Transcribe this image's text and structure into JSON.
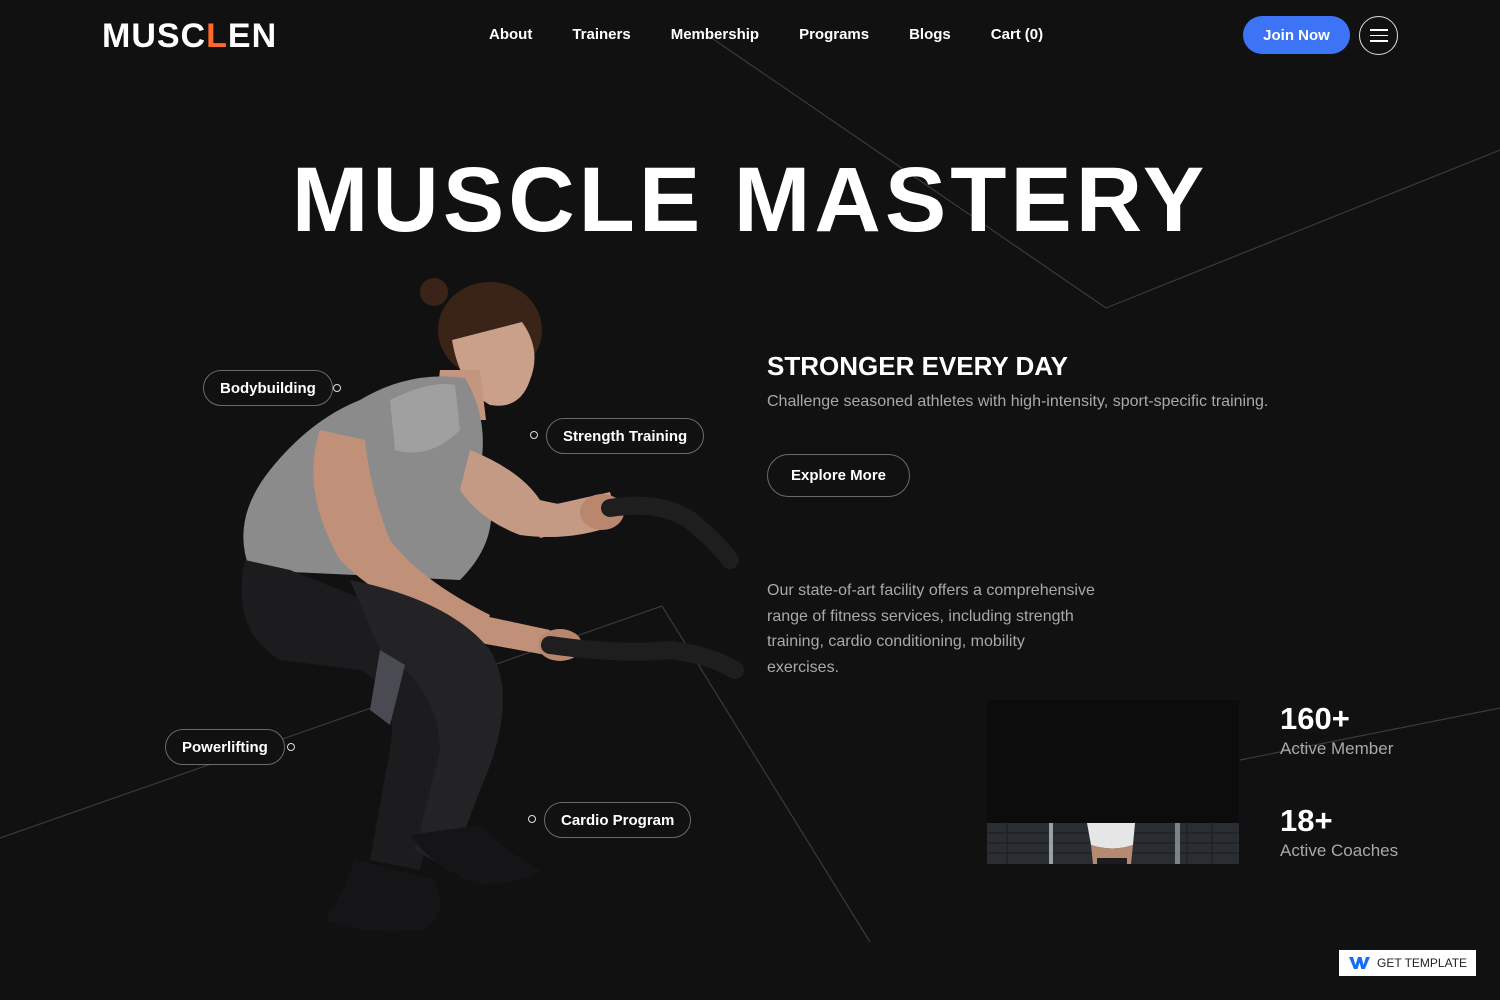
{
  "brand": {
    "prefix": "MUSC",
    "accent_letter": "L",
    "suffix": "EN",
    "accent_color": "#ff6a2a"
  },
  "nav": {
    "items": [
      {
        "label": "About"
      },
      {
        "label": "Trainers"
      },
      {
        "label": "Membership"
      },
      {
        "label": "Programs"
      },
      {
        "label": "Blogs"
      },
      {
        "label": "Cart",
        "count": "(0)"
      }
    ],
    "join_label": "Join Now",
    "menu_icon": "hamburger-icon"
  },
  "hero": {
    "title": "MUSCLE MASTERY",
    "tags": {
      "bodybuilding": "Bodybuilding",
      "strength": "Strength Training",
      "powerlifting": "Powerlifting",
      "cardio": "Cardio Program"
    }
  },
  "content": {
    "subheading": "STRONGER EVERY DAY",
    "subtext": "Challenge seasoned athletes with high-intensity, sport-specific training.",
    "explore_label": "Explore More",
    "description": "Our state-of-art facility offers a comprehensive range of fitness services, including strength training, cardio conditioning, mobility exercises."
  },
  "stats": [
    {
      "value": "160+",
      "label": "Active Member"
    },
    {
      "value": "18+",
      "label": "Active Coaches"
    }
  ],
  "badge": {
    "label": "GET TEMPLATE",
    "icon": "webflow-logo-icon"
  },
  "colors": {
    "background": "#111112",
    "primary": "#3d73f5",
    "muted_text": "#a9a9ad"
  }
}
